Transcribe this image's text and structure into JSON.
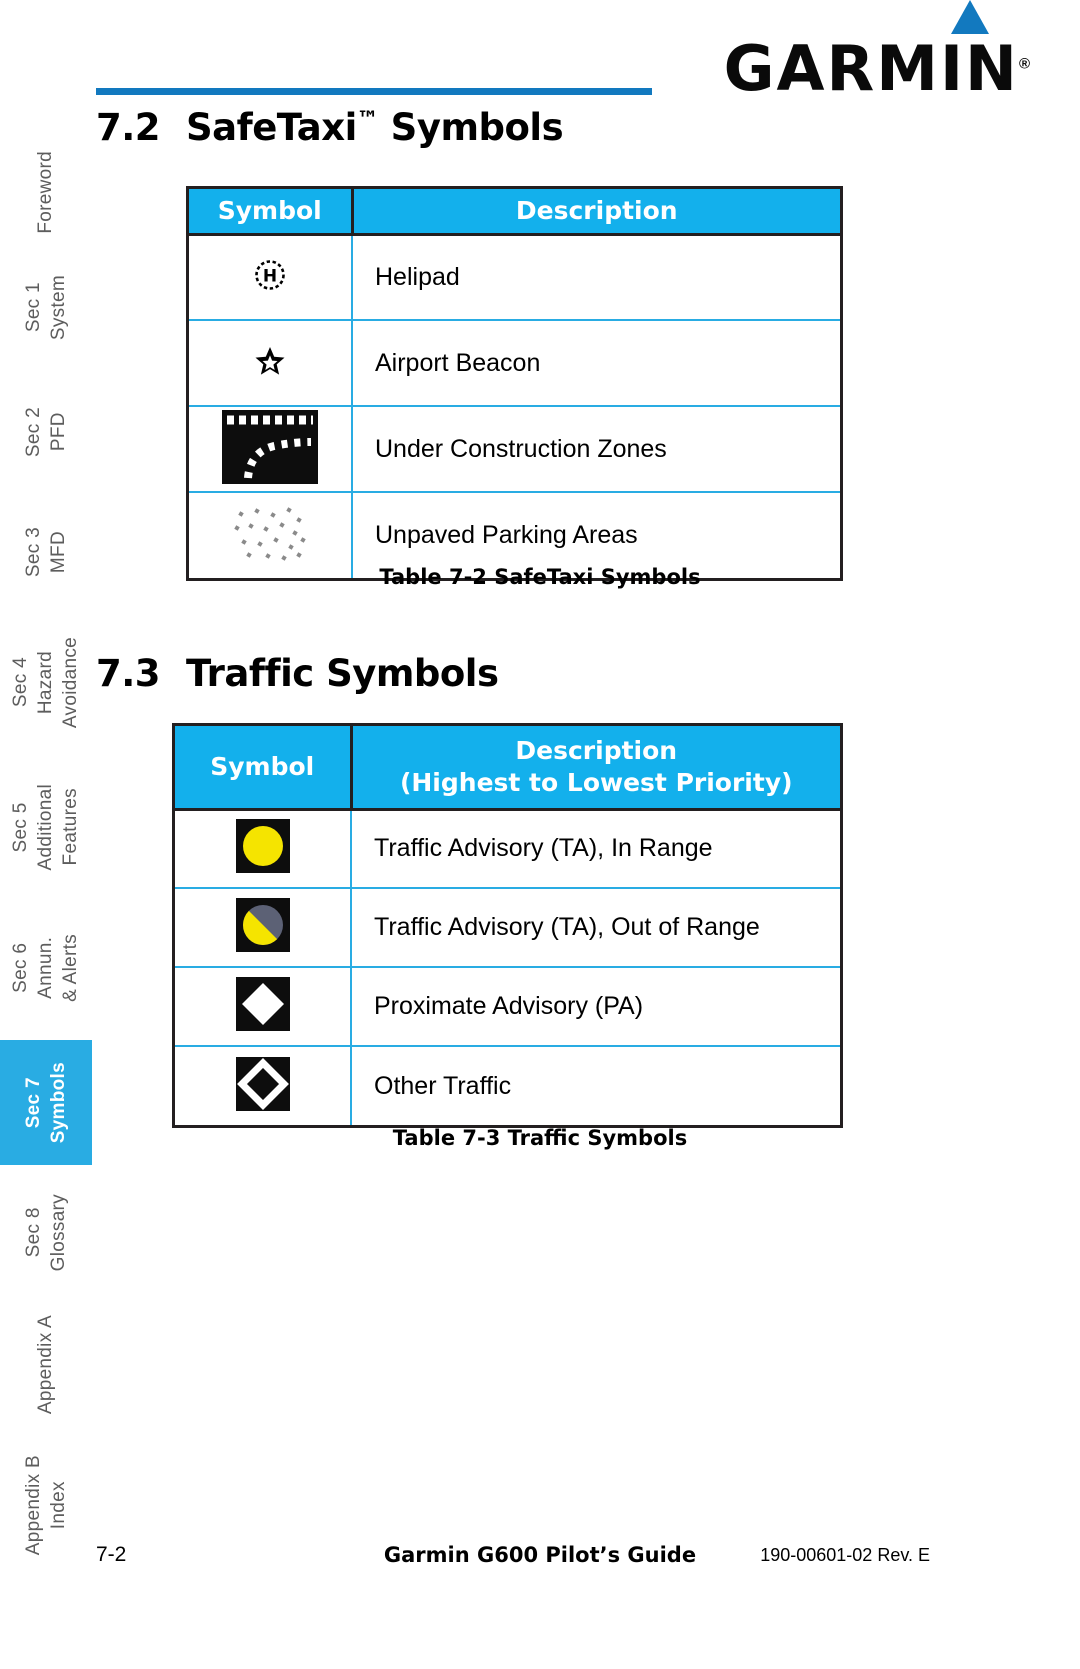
{
  "brand": {
    "name": "GARMIN",
    "registered": "®",
    "triangle_color": "#1279bf"
  },
  "colors": {
    "header_blue": "#13b0ec",
    "rule_blue": "#1279bf",
    "grid_blue": "#29ace3",
    "tab_active_blue": "#29ace3",
    "ta_yellow": "#f5e400",
    "ta_gray": "#5c6175"
  },
  "sidebar": {
    "items": [
      {
        "label": "Foreword",
        "active": false
      },
      {
        "label": "Sec 1\nSystem",
        "active": false
      },
      {
        "label": "Sec 2\nPFD",
        "active": false
      },
      {
        "label": "Sec 3\nMFD",
        "active": false
      },
      {
        "label": "Sec 4\nHazard\nAvoidance",
        "active": false
      },
      {
        "label": "Sec 5\nAdditional\nFeatures",
        "active": false
      },
      {
        "label": "Sec 6\nAnnun.\n& Alerts",
        "active": false
      },
      {
        "label": "Sec 7\nSymbols",
        "active": true
      },
      {
        "label": "Sec 8\nGlossary",
        "active": false
      },
      {
        "label": "Appendix A",
        "active": false
      },
      {
        "label": "Appendix B\nIndex",
        "active": false
      }
    ]
  },
  "sections": [
    {
      "number": "7.2",
      "title_pre": "SafeTaxi",
      "title_tm": "™",
      "title_post": " Symbols"
    },
    {
      "number": "7.3",
      "title_pre": "Traffic Symbols",
      "title_tm": "",
      "title_post": ""
    }
  ],
  "table_safetaxi": {
    "headers": {
      "symbol": "Symbol",
      "description": "Description"
    },
    "rows": [
      {
        "symbol": "helipad-icon",
        "description": "Helipad"
      },
      {
        "symbol": "airport-beacon-icon",
        "description": "Airport Beacon"
      },
      {
        "symbol": "under-construction-icon",
        "description": "Under Construction Zones"
      },
      {
        "symbol": "unpaved-parking-icon",
        "description": "Unpaved Parking Areas"
      }
    ],
    "caption": "Table 7-2  SafeTaxi Symbols"
  },
  "table_traffic": {
    "headers": {
      "symbol": "Symbol",
      "description_line1": "Description",
      "description_line2": "(Highest to Lowest Priority)"
    },
    "rows": [
      {
        "symbol": "ta-in-range-icon",
        "description": "Traffic Advisory (TA), In Range"
      },
      {
        "symbol": "ta-out-of-range-icon",
        "description": "Traffic Advisory (TA), Out of Range"
      },
      {
        "symbol": "proximate-advisory-icon",
        "description": "Proximate Advisory (PA)"
      },
      {
        "symbol": "other-traffic-icon",
        "description": "Other Traffic"
      }
    ],
    "caption": "Table 7-3  Traffic Symbols"
  },
  "footer": {
    "page_number": "7-2",
    "document_title": "Garmin G600 Pilot’s Guide",
    "part_number": "190-00601-02  Rev. E"
  }
}
